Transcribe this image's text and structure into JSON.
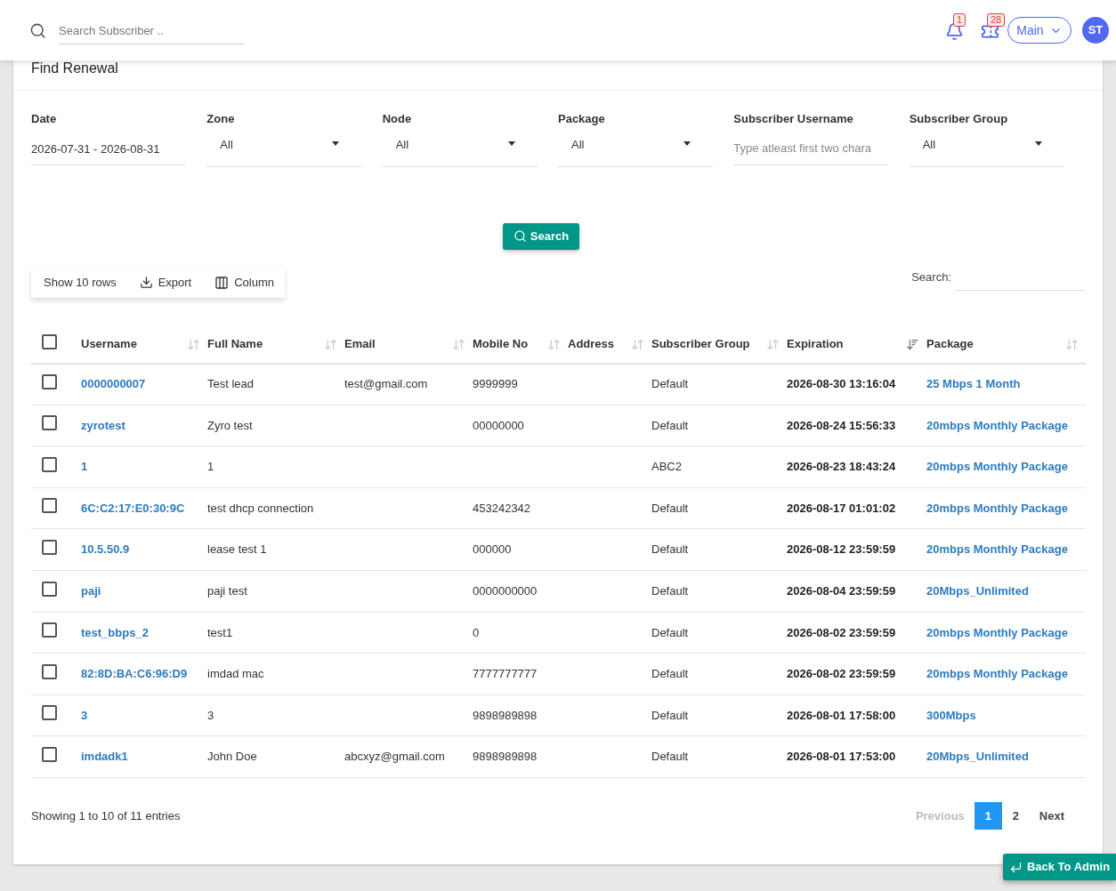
{
  "topbar": {
    "search_placeholder": "Search Subscriber ..",
    "notifications_count": "1",
    "tickets_count": "28",
    "branch": "Main",
    "avatar": "ST"
  },
  "title": "Find Renewal",
  "filters": [
    {
      "kind": "text",
      "label": "Date",
      "value": "2026-07-31 - 2026-08-31"
    },
    {
      "kind": "select",
      "label": "Zone",
      "value": "All"
    },
    {
      "kind": "select",
      "label": "Node",
      "value": "All"
    },
    {
      "kind": "select",
      "label": "Package",
      "value": "All"
    },
    {
      "kind": "input",
      "label": "Subscriber Username",
      "placeholder": "Type atleast first two chara"
    },
    {
      "kind": "select",
      "label": "Subscriber Group",
      "value": "All"
    }
  ],
  "search_button": "Search",
  "toolbar": [
    {
      "kind": "rows",
      "label": "Show 10 rows"
    },
    {
      "kind": "export",
      "label": "Export"
    },
    {
      "kind": "column",
      "label": "Column"
    }
  ],
  "table_search_label": "Search:",
  "table": {
    "select_all_checked": false,
    "columns": [
      {
        "label": "Username",
        "sorted": false
      },
      {
        "label": "Full Name",
        "sorted": false
      },
      {
        "label": "Email",
        "sorted": false
      },
      {
        "label": "Mobile No",
        "sorted": false
      },
      {
        "label": "Address",
        "sorted": false
      },
      {
        "label": "Subscriber Group",
        "sorted": false
      },
      {
        "label": "Expiration",
        "sorted": true
      },
      {
        "label": "Package",
        "sorted": false
      }
    ],
    "rows": [
      {
        "checked": false,
        "username": "0000000007",
        "full_name": "Test lead",
        "email": "test@gmail.com",
        "mobile": "9999999",
        "group": "Default",
        "expiration": "2026-08-30 13:16:04",
        "package": "25 Mbps 1 Month"
      },
      {
        "checked": false,
        "username": "zyrotest",
        "full_name": "Zyro test",
        "mobile": "00000000",
        "group": "Default",
        "expiration": "2026-08-24 15:56:33",
        "package": "20mbps Monthly Package"
      },
      {
        "checked": false,
        "username": "1",
        "full_name": "1",
        "group": "ABC2",
        "expiration": "2026-08-23 18:43:24",
        "package": "20mbps Monthly Package"
      },
      {
        "checked": false,
        "username": "6C:C2:17:E0:30:9C",
        "full_name": "test dhcp connection",
        "mobile": "453242342",
        "group": "Default",
        "expiration": "2026-08-17 01:01:02",
        "package": "20mbps Monthly Package"
      },
      {
        "checked": false,
        "username": "10.5.50.9",
        "full_name": "lease test 1",
        "mobile": "000000",
        "group": "Default",
        "expiration": "2026-08-12 23:59:59",
        "package": "20mbps Monthly Package"
      },
      {
        "checked": false,
        "username": "paji",
        "full_name": "paji test",
        "mobile": "0000000000",
        "group": "Default",
        "expiration": "2026-08-04 23:59:59",
        "package": "20Mbps_Unlimited"
      },
      {
        "checked": false,
        "username": "test_bbps_2",
        "full_name": "test1",
        "mobile": "0",
        "group": "Default",
        "expiration": "2026-08-02 23:59:59",
        "package": "20mbps Monthly Package"
      },
      {
        "checked": false,
        "username": "82:8D:BA:C6:96:D9",
        "full_name": "imdad mac",
        "mobile": "7777777777",
        "group": "Default",
        "expiration": "2026-08-02 23:59:59",
        "package": "20mbps Monthly Package"
      },
      {
        "checked": false,
        "username": "3",
        "full_name": "3",
        "mobile": "9898989898",
        "group": "Default",
        "expiration": "2026-08-01 17:58:00",
        "package": "300Mbps"
      },
      {
        "checked": false,
        "username": "imdadk1",
        "full_name": "John Doe",
        "email": "abcxyz@gmail.com",
        "mobile": "9898989898",
        "group": "Default",
        "expiration": "2026-08-01 17:53:00",
        "package": "20Mbps_Unlimited"
      }
    ]
  },
  "footer_info": "Showing 1 to 10 of 11 entries",
  "pagination": {
    "previous": {
      "label": "Previous",
      "disabled": true
    },
    "pages": [
      {
        "label": "1",
        "selected": true
      },
      {
        "label": "2",
        "selected": false
      }
    ],
    "next": {
      "label": "Next",
      "disabled": false
    }
  },
  "back_button": "Back To Admin"
}
